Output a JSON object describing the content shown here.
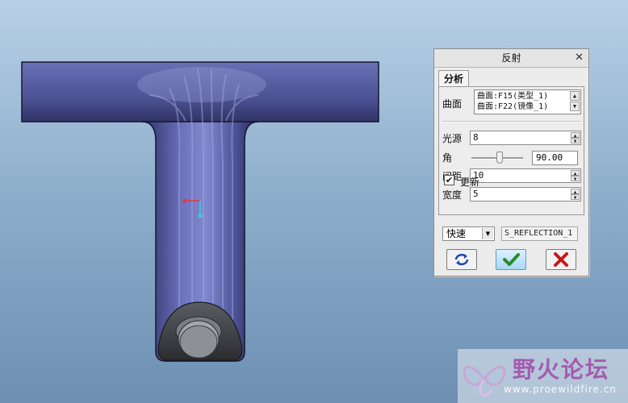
{
  "dialog": {
    "title": "反射",
    "close_glyph": "✕",
    "tab_label": "分析",
    "surface_label": "曲面",
    "surfaces": [
      "曲面:F15(类型_1)",
      "曲面:F22(镜像_1)"
    ],
    "light_source_label": "光源",
    "light_source_value": "8",
    "angle_label": "角",
    "angle_value": "90.00",
    "angle_slider_fraction": 0.55,
    "spacing_label": "间距",
    "spacing_value": "10",
    "width_label": "宽度",
    "width_value": "5",
    "update_label": "更新",
    "update_checked": true,
    "mode_value": "快速",
    "name_value": "S_REFLECTION_1"
  },
  "watermark": {
    "title": "野火论坛",
    "url": "www.proewildfire.cn"
  },
  "colors": {
    "model_body": "#4a4e92",
    "highlight": "#a7acd8",
    "accept": "#2b8a2b",
    "cancel": "#c41a1a",
    "axis_x": "#e23a3a",
    "axis_y": "#35d0e0"
  },
  "icons": [
    "repeat-icon",
    "checkmark-icon",
    "cancel-icon",
    "close-icon",
    "scroll-up-icon",
    "scroll-down-icon"
  ]
}
